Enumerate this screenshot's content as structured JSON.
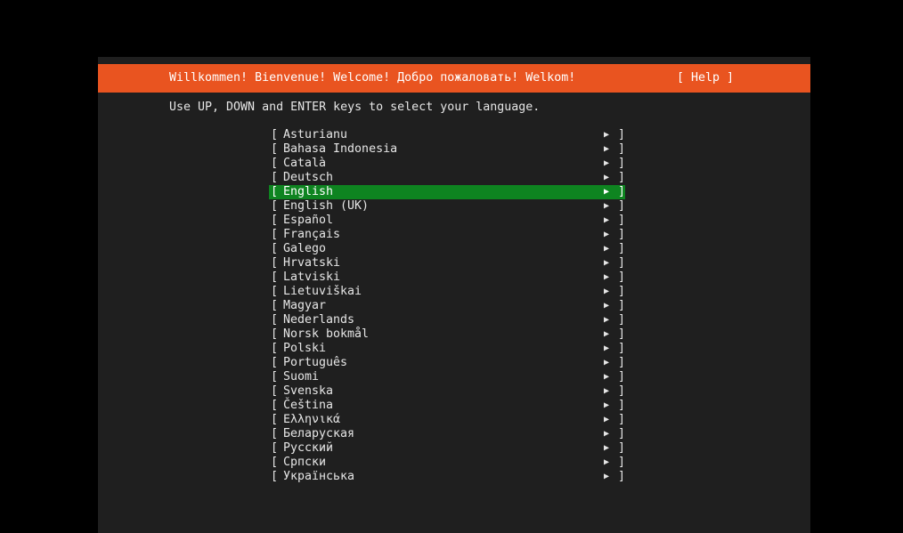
{
  "header": {
    "title": "Willkommen! Bienvenue! Welcome! Добро пожаловать! Welkom!",
    "help_label": "[ Help ]"
  },
  "instructions": "Use UP, DOWN and ENTER keys to select your language.",
  "colors": {
    "header_bg": "#e95420",
    "selected_bg": "#0e8420",
    "panel_bg": "#1f1f1f"
  },
  "languages": [
    {
      "label": "Asturianu"
    },
    {
      "label": "Bahasa Indonesia"
    },
    {
      "label": "Català"
    },
    {
      "label": "Deutsch"
    },
    {
      "label": "English",
      "selected": true
    },
    {
      "label": "English (UK)"
    },
    {
      "label": "Español"
    },
    {
      "label": "Français"
    },
    {
      "label": "Galego"
    },
    {
      "label": "Hrvatski"
    },
    {
      "label": "Latviski"
    },
    {
      "label": "Lietuviškai"
    },
    {
      "label": "Magyar"
    },
    {
      "label": "Nederlands"
    },
    {
      "label": "Norsk bokmål"
    },
    {
      "label": "Polski"
    },
    {
      "label": "Português"
    },
    {
      "label": "Suomi"
    },
    {
      "label": "Svenska"
    },
    {
      "label": "Čeština"
    },
    {
      "label": "Ελληνικά"
    },
    {
      "label": "Беларуская"
    },
    {
      "label": "Русский"
    },
    {
      "label": "Српски"
    },
    {
      "label": "Українська"
    }
  ],
  "list_glyphs": {
    "open": "[",
    "close": "]",
    "arrow": "▶"
  }
}
